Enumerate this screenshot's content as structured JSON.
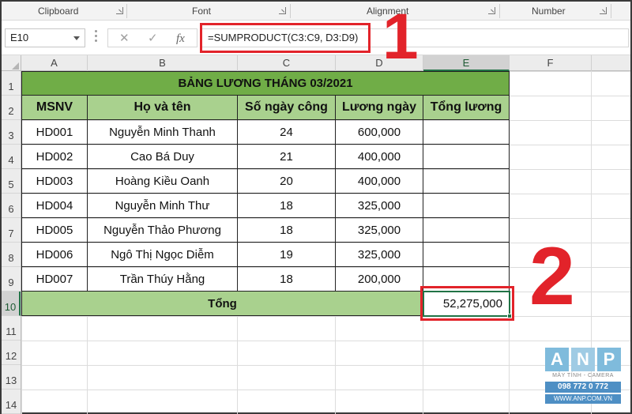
{
  "ribbon": {
    "groups": [
      "Clipboard",
      "Font",
      "Alignment",
      "Number"
    ]
  },
  "formula_bar": {
    "name_box": "E10",
    "cancel_icon": "close-icon",
    "enter_icon": "check-icon",
    "fx_label": "fx",
    "formula": "=SUMPRODUCT(C3:C9, D3:D9)"
  },
  "annotations": {
    "step1": "1",
    "step2": "2",
    "highlight_color": "#e2232a"
  },
  "columns": [
    "A",
    "B",
    "C",
    "D",
    "E",
    "F"
  ],
  "rows": [
    "1",
    "2",
    "3",
    "4",
    "5",
    "6",
    "7",
    "8",
    "9",
    "10",
    "11",
    "12",
    "13",
    "14"
  ],
  "sheet": {
    "title": "BẢNG LƯƠNG THÁNG 03/2021",
    "headers": [
      "MSNV",
      "Họ và tên",
      "Số ngày công",
      "Lương ngày",
      "Tổng lương"
    ],
    "records": [
      {
        "id": "HD001",
        "name": "Nguyễn Minh Thanh",
        "days": "24",
        "rate": "600,000",
        "total": ""
      },
      {
        "id": "HD002",
        "name": "Cao Bá Duy",
        "days": "21",
        "rate": "400,000",
        "total": ""
      },
      {
        "id": "HD003",
        "name": "Hoàng Kiều Oanh",
        "days": "20",
        "rate": "400,000",
        "total": ""
      },
      {
        "id": "HD004",
        "name": "Nguyễn Minh Thư",
        "days": "18",
        "rate": "325,000",
        "total": ""
      },
      {
        "id": "HD005",
        "name": "Nguyễn Thảo Phương",
        "days": "18",
        "rate": "325,000",
        "total": ""
      },
      {
        "id": "HD006",
        "name": "Ngô Thị Ngọc Diễm",
        "days": "19",
        "rate": "325,000",
        "total": ""
      },
      {
        "id": "HD007",
        "name": "Trần Thúy Hằng",
        "days": "18",
        "rate": "200,000",
        "total": ""
      }
    ],
    "total_label": "Tổng",
    "total_value": "52,275,000",
    "colors": {
      "title_bg": "#70ad47",
      "header_bg": "#a9d18e",
      "selection": "#217346"
    }
  },
  "logo": {
    "letters": [
      "A",
      "N",
      "P"
    ],
    "tagline": "MÁY TÍNH - CAMERA",
    "phone": "098 772 0 772",
    "website": "WWW.ANP.COM.VN"
  }
}
